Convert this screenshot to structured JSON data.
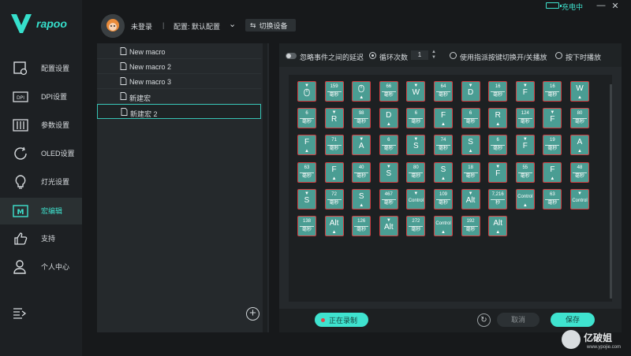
{
  "app": {
    "brand": "rapoo",
    "accent": "#3fe3cf",
    "alert": "#cf3f42"
  },
  "nav": [
    {
      "label": "配置设置",
      "icon": "config-icon"
    },
    {
      "label": "DPI设置",
      "icon": "dpi-icon"
    },
    {
      "label": "参数设置",
      "icon": "sliders-icon"
    },
    {
      "label": "OLED设置",
      "icon": "oled-icon"
    },
    {
      "label": "灯光设置",
      "icon": "bulb-icon"
    },
    {
      "label": "宏编辑",
      "icon": "macro-icon"
    },
    {
      "label": "支持",
      "icon": "thumbs-up-icon"
    },
    {
      "label": "个人中心",
      "icon": "user-icon"
    }
  ],
  "topbar": {
    "login": "未登录",
    "separator": "|",
    "profile": "配置: 默认配置",
    "switch_label": "切换设备",
    "charging": "充电中"
  },
  "macros": [
    "New macro",
    "New macro 2",
    "New macro 3",
    "新建宏",
    "新建宏 2"
  ],
  "options": {
    "ignore_delay": "忽略事件之间的延迟",
    "loop": "循环次数",
    "loop_count": "1",
    "toggle": "使用指派按键切换开/关播放",
    "hold": "按下时播放"
  },
  "steps": [
    {
      "type": "key",
      "label": "mouse",
      "dir": "down"
    },
    {
      "type": "delay",
      "value": "159",
      "unit": "毫秒"
    },
    {
      "type": "key",
      "label": "mouse",
      "dir": "up"
    },
    {
      "type": "delay",
      "value": "66",
      "unit": "毫秒"
    },
    {
      "type": "key",
      "label": "W",
      "dir": "down"
    },
    {
      "type": "delay",
      "value": "64",
      "unit": "毫秒"
    },
    {
      "type": "key",
      "label": "D",
      "dir": "down"
    },
    {
      "type": "delay",
      "value": "16",
      "unit": "毫秒"
    },
    {
      "type": "key",
      "label": "F",
      "dir": "down"
    },
    {
      "type": "delay",
      "value": "16",
      "unit": "毫秒"
    },
    {
      "type": "key",
      "label": "W",
      "dir": "up"
    },
    {
      "type": "delay",
      "value": "6",
      "unit": "毫秒"
    },
    {
      "type": "key",
      "label": "R",
      "dir": "down"
    },
    {
      "type": "delay",
      "value": "98",
      "unit": "毫秒"
    },
    {
      "type": "key",
      "label": "D",
      "dir": "up"
    },
    {
      "type": "delay",
      "value": "6",
      "unit": "毫秒"
    },
    {
      "type": "key",
      "label": "F",
      "dir": "up"
    },
    {
      "type": "delay",
      "value": "6",
      "unit": "毫秒"
    },
    {
      "type": "key",
      "label": "R",
      "dir": "up"
    },
    {
      "type": "delay",
      "value": "124",
      "unit": "毫秒"
    },
    {
      "type": "key",
      "label": "F",
      "dir": "down"
    },
    {
      "type": "delay",
      "value": "80",
      "unit": "毫秒"
    },
    {
      "type": "key",
      "label": "F",
      "dir": "up"
    },
    {
      "type": "delay",
      "value": "71",
      "unit": "毫秒"
    },
    {
      "type": "key",
      "label": "A",
      "dir": "down"
    },
    {
      "type": "delay",
      "value": "6",
      "unit": "毫秒"
    },
    {
      "type": "key",
      "label": "S",
      "dir": "down"
    },
    {
      "type": "delay",
      "value": "74",
      "unit": "毫秒"
    },
    {
      "type": "key",
      "label": "S",
      "dir": "up"
    },
    {
      "type": "delay",
      "value": "6",
      "unit": "毫秒"
    },
    {
      "type": "key",
      "label": "F",
      "dir": "down"
    },
    {
      "type": "delay",
      "value": "19",
      "unit": "毫秒"
    },
    {
      "type": "key",
      "label": "A",
      "dir": "up"
    },
    {
      "type": "delay",
      "value": "63",
      "unit": "毫秒"
    },
    {
      "type": "key",
      "label": "F",
      "dir": "up"
    },
    {
      "type": "delay",
      "value": "40",
      "unit": "毫秒"
    },
    {
      "type": "key",
      "label": "S",
      "dir": "down"
    },
    {
      "type": "delay",
      "value": "80",
      "unit": "毫秒"
    },
    {
      "type": "key",
      "label": "S",
      "dir": "up"
    },
    {
      "type": "delay",
      "value": "18",
      "unit": "毫秒"
    },
    {
      "type": "key",
      "label": "F",
      "dir": "down"
    },
    {
      "type": "delay",
      "value": "55",
      "unit": "毫秒"
    },
    {
      "type": "key",
      "label": "F",
      "dir": "up"
    },
    {
      "type": "delay",
      "value": "48",
      "unit": "毫秒"
    },
    {
      "type": "key",
      "label": "S",
      "dir": "down"
    },
    {
      "type": "delay",
      "value": "72",
      "unit": "毫秒"
    },
    {
      "type": "key",
      "label": "S",
      "dir": "up"
    },
    {
      "type": "delay",
      "value": "467",
      "unit": "毫秒"
    },
    {
      "type": "key",
      "label": "Control",
      "dir": "down"
    },
    {
      "type": "delay",
      "value": "109",
      "unit": "毫秒"
    },
    {
      "type": "key",
      "label": "Alt",
      "dir": "down"
    },
    {
      "type": "delay",
      "value": "7,216",
      "unit": "秒"
    },
    {
      "type": "key",
      "label": "Control",
      "dir": "up"
    },
    {
      "type": "delay",
      "value": "63",
      "unit": "毫秒"
    },
    {
      "type": "key",
      "label": "Control",
      "dir": "down"
    },
    {
      "type": "delay",
      "value": "138",
      "unit": "毫秒"
    },
    {
      "type": "key",
      "label": "Alt",
      "dir": "up"
    },
    {
      "type": "delay",
      "value": "126",
      "unit": "毫秒"
    },
    {
      "type": "key",
      "label": "Alt",
      "dir": "down"
    },
    {
      "type": "delay",
      "value": "272",
      "unit": "毫秒"
    },
    {
      "type": "key",
      "label": "Control",
      "dir": "up"
    },
    {
      "type": "delay",
      "value": "192",
      "unit": "毫秒"
    },
    {
      "type": "key",
      "label": "Alt",
      "dir": "up"
    }
  ],
  "bottom": {
    "record": "正在录制",
    "cancel": "取消",
    "save": "保存"
  },
  "watermark": {
    "title": "亿破姐",
    "url": "www.ypojie.com"
  }
}
